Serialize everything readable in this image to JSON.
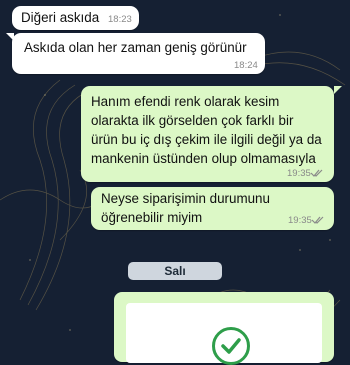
{
  "messages": [
    {
      "text": [
        "Diğeri askıda"
      ],
      "time": "18:23"
    },
    {
      "text": [
        "Askıda olan her zaman geniş görünür"
      ],
      "time": "18:24"
    },
    {
      "text": [
        "Hanım efendi renk olarak kesim",
        "olarakta ilk görselden çok farklı bir",
        "ürün bu iç dış çekim ile ilgili değil ya da",
        "mankenin üstünden olup olmamasıyla"
      ],
      "time": "19:35"
    },
    {
      "text": [
        "Neyse siparişimin durumunu",
        "öğrenebilir miyim"
      ],
      "time": "19:35"
    }
  ],
  "date_separator": "Salı",
  "icons": {
    "read_receipt": "double-check-icon",
    "confirm": "check-circle-icon"
  },
  "colors": {
    "incoming": "#ffffff",
    "outgoing": "#dcf8c6",
    "background": "#152033",
    "check": "#2e9e4a"
  }
}
